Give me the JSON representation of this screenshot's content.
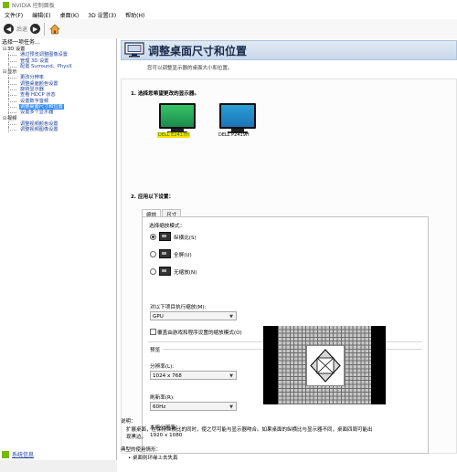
{
  "window": {
    "title": "NVIDIA 控制面板"
  },
  "menu": [
    "文件(F)",
    "编辑(E)",
    "桌面(K)",
    "3D 设置(3)",
    "帮助(H)"
  ],
  "toolbar": {
    "back_label": "后退",
    "forward_symbol": "▶",
    "back_symbol": "◀"
  },
  "left_pane": {
    "header": "选择一项任务...",
    "tree": [
      {
        "type": "cat",
        "label": "3D 设置",
        "toggle": "⊟"
      },
      {
        "type": "item",
        "label": "通过预览调整图像设置"
      },
      {
        "type": "item",
        "label": "管理 3D 设置"
      },
      {
        "type": "item",
        "label": "配置 Surround、PhysX"
      },
      {
        "type": "cat",
        "label": "显示",
        "toggle": "⊟"
      },
      {
        "type": "item",
        "label": "更改分辨率"
      },
      {
        "type": "item",
        "label": "调整桌面颜色设置"
      },
      {
        "type": "item",
        "label": "旋转显示器"
      },
      {
        "type": "item",
        "label": "查看 HDCP 状态"
      },
      {
        "type": "item",
        "label": "设置数字音频"
      },
      {
        "type": "item",
        "label": "调整桌面尺寸和位置",
        "selected": true
      },
      {
        "type": "item",
        "label": "设置多个显示器"
      },
      {
        "type": "cat",
        "label": "视频",
        "toggle": "⊟"
      },
      {
        "type": "item",
        "label": "调整视频颜色设置"
      },
      {
        "type": "item",
        "label": "调整视频图像设置"
      }
    ],
    "system_info": "系统信息"
  },
  "page": {
    "title": "调整桌面尺寸和位置",
    "description": "您可以调整显示器的桌面大小和位置。",
    "section1_title": "1.  选择您希望更改的显示器。",
    "monitors": [
      {
        "label": "DELL E2417H",
        "selected": true
      },
      {
        "label": "DELL P2419H",
        "selected": false
      }
    ],
    "section2_title": "2.  应用以下设置：",
    "tabs": [
      "缩放",
      "尺寸"
    ],
    "scaling_mode_label": "选择缩放模式：",
    "scaling_options": [
      {
        "label": "纵横比(S)",
        "checked": true
      },
      {
        "label": "全屏(U)",
        "checked": false
      },
      {
        "label": "无缩放(N)",
        "checked": false
      }
    ],
    "perform_scaling_label": "对以下项目执行缩放(M):",
    "perform_scaling_value": "GPU",
    "override_checkbox_label": "覆盖由游戏和程序设置的缩放模式(O)",
    "preview_label": "预览",
    "resolution_label": "分辨率(L):",
    "resolution_value": "1024 x 768",
    "refresh_label": "刷新率(R):",
    "refresh_value": "60Hz",
    "native_label": "本机分辨率：",
    "native_value": "1920 x 1080",
    "desc_label": "说明：",
    "desc_text_1": "扩展桌面，在保持纵横比的同时，使之尽可能与显示器吻合。如果桌面的纵横比与显示器不同，桌面四周可能出",
    "desc_text_2": "现黑边。",
    "typical_label": "典型的使用情形：",
    "typical_item": "• 桌面则环缘上去失真"
  }
}
